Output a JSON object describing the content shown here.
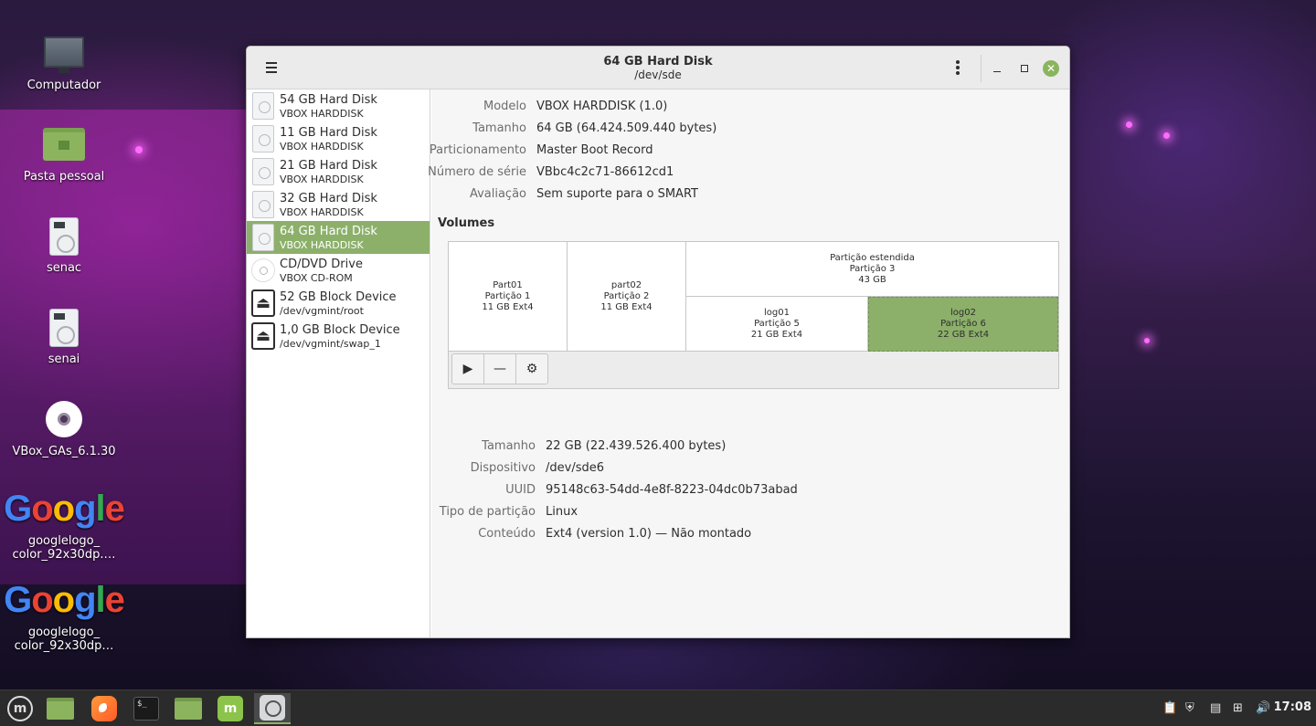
{
  "desktop": {
    "icons": [
      {
        "label": "Computador"
      },
      {
        "label": "Pasta pessoal"
      },
      {
        "label": "senac"
      },
      {
        "label": "senai"
      },
      {
        "label": "VBox_GAs_6.1.30"
      },
      {
        "label": "googlelogo_\ncolor_92x30dp.…"
      },
      {
        "label": "googlelogo_\ncolor_92x30dp…"
      }
    ],
    "google_text": "Google"
  },
  "window": {
    "title": "64 GB Hard Disk",
    "subtitle": "/dev/sde",
    "close_glyph": "✕"
  },
  "sidebar": {
    "items": [
      {
        "name": "54 GB Hard Disk",
        "sub": "VBOX HARDDISK",
        "icon": "hard-disk-icon"
      },
      {
        "name": "11 GB Hard Disk",
        "sub": "VBOX HARDDISK",
        "icon": "hard-disk-icon"
      },
      {
        "name": "21 GB Hard Disk",
        "sub": "VBOX HARDDISK",
        "icon": "hard-disk-icon"
      },
      {
        "name": "32 GB Hard Disk",
        "sub": "VBOX HARDDISK",
        "icon": "hard-disk-icon"
      },
      {
        "name": "64 GB Hard Disk",
        "sub": "VBOX HARDDISK",
        "icon": "hard-disk-icon",
        "selected": true
      },
      {
        "name": "CD/DVD Drive",
        "sub": "VBOX CD-ROM",
        "icon": "optical-drive-icon"
      },
      {
        "name": "52 GB Block Device",
        "sub": "/dev/vgmint/root",
        "icon": "eject-icon"
      },
      {
        "name": "1,0 GB Block Device",
        "sub": "/dev/vgmint/swap_1",
        "icon": "eject-icon"
      }
    ]
  },
  "drive_info": {
    "model_label": "Modelo",
    "model_value": "VBOX HARDDISK (1.0)",
    "size_label": "Tamanho",
    "size_value": "64 GB (64.424.509.440 bytes)",
    "partitioning_label": "Particionamento",
    "partitioning_value": "Master Boot Record",
    "serial_label": "Número de série",
    "serial_value": "VBbc4c2c71-86612cd1",
    "assessment_label": "Avaliação",
    "assessment_value": "Sem suporte para o SMART"
  },
  "volumes": {
    "title": "Volumes",
    "part01": {
      "name": "Part01",
      "num": "Partição 1",
      "info": "11 GB Ext4"
    },
    "part02": {
      "name": "part02",
      "num": "Partição 2",
      "info": "11 GB Ext4"
    },
    "extended": {
      "name": "Partição estendida",
      "num": "Partição 3",
      "info": "43 GB"
    },
    "log01": {
      "name": "log01",
      "num": "Partição 5",
      "info": "21 GB Ext4"
    },
    "log02": {
      "name": "log02",
      "num": "Partição 6",
      "info": "22 GB Ext4"
    },
    "tools": {
      "mount": "▶",
      "remove": "—",
      "settings": "⚙"
    }
  },
  "partition_info": {
    "size_label": "Tamanho",
    "size_value": "22 GB (22.439.526.400 bytes)",
    "device_label": "Dispositivo",
    "device_value": "/dev/sde6",
    "uuid_label": "UUID",
    "uuid_value": "95148c63-54dd-4e8f-8223-04dc0b73abad",
    "type_label": "Tipo de partição",
    "type_value": "Linux",
    "content_label": "Conteúdo",
    "content_value": "Ext4 (version 1.0) — Não montado"
  },
  "taskbar": {
    "menu_glyph": "m",
    "terminal_glyph": "$_",
    "mint_glyph": "m",
    "tray_icons": [
      "clipboard-icon",
      "shield-icon",
      "document-icon",
      "network-icon",
      "volume-icon"
    ],
    "clock": "17:08"
  },
  "colors": {
    "accent": "#8cb06a",
    "titlebar": "#ebebeb",
    "taskbar": "#2b2b2b"
  }
}
